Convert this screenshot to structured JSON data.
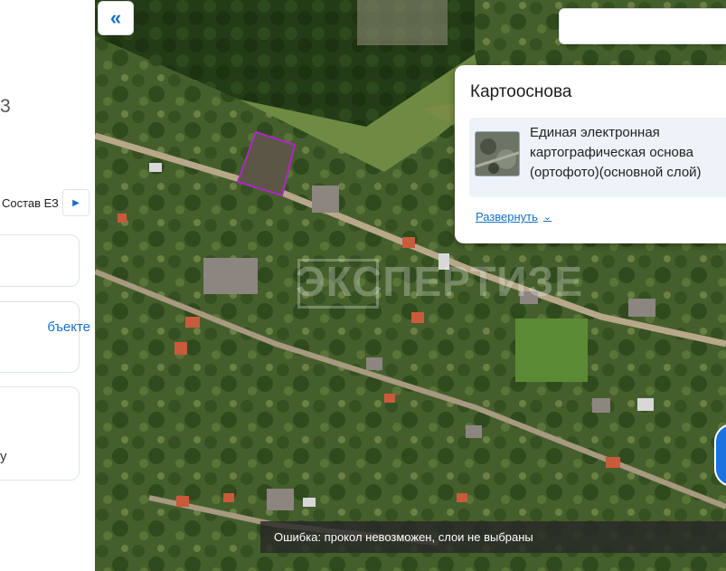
{
  "left_panel": {
    "partial_number": "3",
    "tab_label": "Состав ЕЗ",
    "tab_arrow": "chevron-right-icon",
    "card2_link": "бъекте",
    "card3_mark": "y"
  },
  "map": {
    "collapse_icon": "double-chevron-left-icon",
    "collapse_glyph": "«",
    "search_placeholder": "",
    "watermark_text": "ЭКСПЕРТИЗЕ",
    "highlight_color": "#b026c8"
  },
  "basemap_popup": {
    "title": "Картооснова",
    "layer_name": "Единая электронная картографическая основа (ортофото)(основной слой)",
    "expand_label": "Развернуть",
    "expand_icon": "chevron-down-icon"
  },
  "status": {
    "error_message": "Ошибка: прокол невозможен, слои не выбраны"
  },
  "colors": {
    "accent": "#1a6fc9",
    "error_bg": "#282828"
  }
}
